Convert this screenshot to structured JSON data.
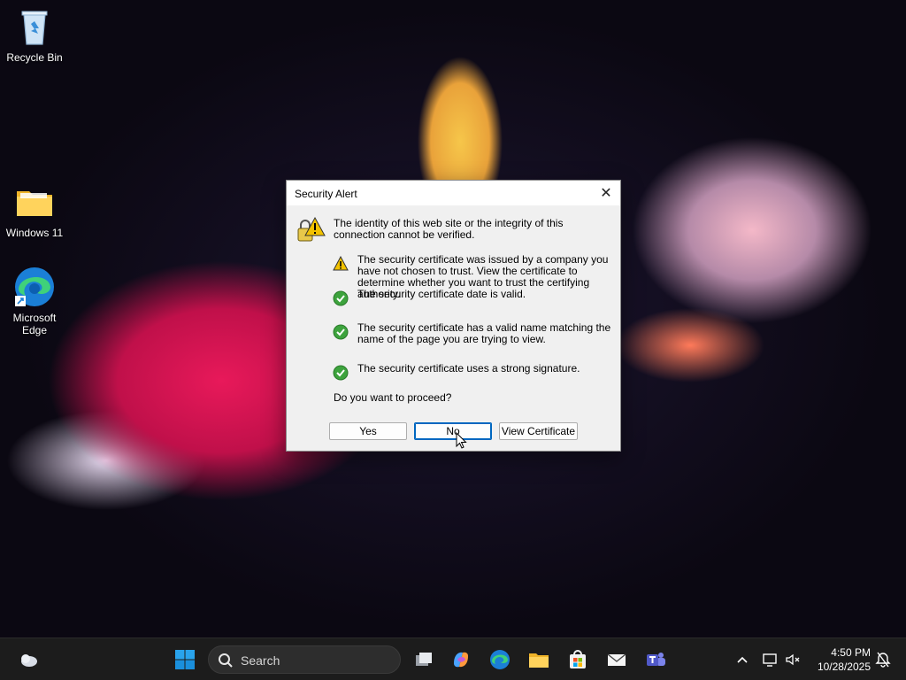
{
  "desktop": {
    "icons": [
      {
        "label": "Recycle Bin"
      },
      {
        "label": "Windows 11"
      },
      {
        "label": "Microsoft Edge"
      }
    ]
  },
  "dialog": {
    "title": "Security Alert",
    "message": "The identity of this web site or the integrity of this connection cannot be verified.",
    "items": [
      {
        "status": "warning",
        "text": "The security certificate was issued by a company you have not chosen to trust. View the certificate to determine whether you want to trust the certifying authority."
      },
      {
        "status": "ok",
        "text": "The security certificate date is valid."
      },
      {
        "status": "ok",
        "text": "The security certificate has a valid name matching the name of the page you are trying to view."
      },
      {
        "status": "ok",
        "text": "The security certificate uses a strong signature."
      }
    ],
    "question": "Do you want to proceed?",
    "buttons": {
      "yes": "Yes",
      "no": "No",
      "view_certificate": "View Certificate"
    }
  },
  "taskbar": {
    "search_label": "Search",
    "time": "4:50 PM",
    "date": "10/28/2025"
  },
  "colors": {
    "accent": "#0067c0",
    "ok_green": "#3da33d",
    "warning_yellow": "#f2c200"
  }
}
